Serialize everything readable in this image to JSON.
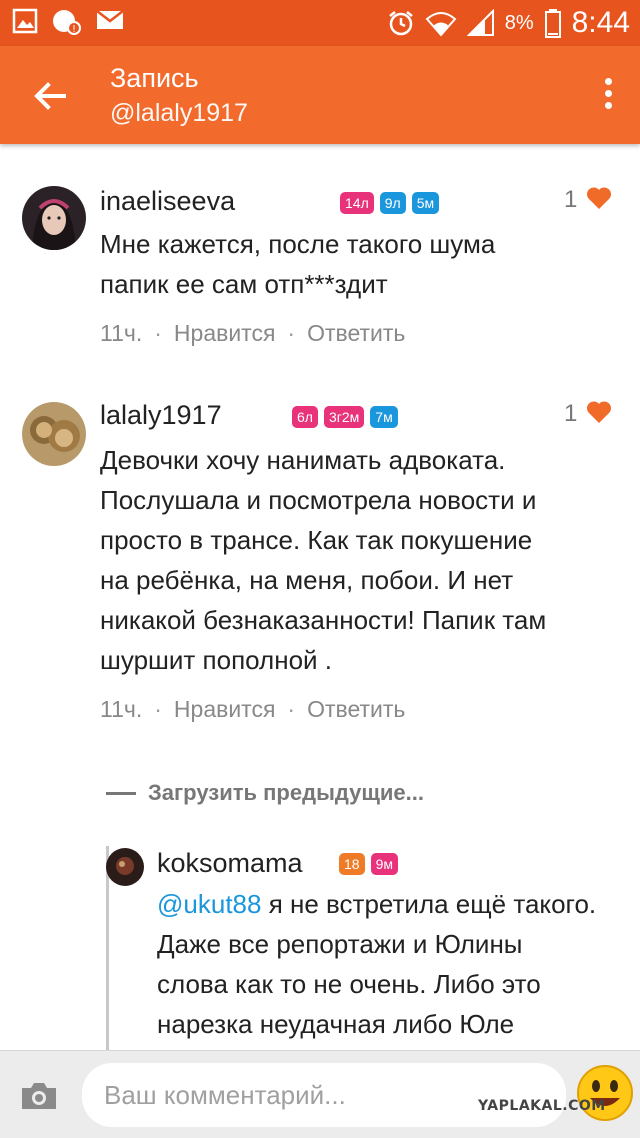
{
  "status_bar": {
    "battery_pct": "8%",
    "time": "8:44"
  },
  "app_bar": {
    "title": "Запись",
    "subtitle": "@lalaly1917"
  },
  "comments": [
    {
      "username": "inaeliseeva",
      "badges": [
        {
          "text": "14л",
          "color": "#e8327a"
        },
        {
          "text": "9л",
          "color": "#1a96dc"
        },
        {
          "text": "5м",
          "color": "#1a96dc"
        }
      ],
      "likes": "1",
      "text_lines": [
        "Мне кажется,  после такого шума",
        "папик ее сам отп***здит"
      ],
      "time": "11ч.",
      "like_label": "Нравится",
      "reply_label": "Ответить"
    },
    {
      "username": "lalaly1917",
      "badges": [
        {
          "text": "6л",
          "color": "#e8327a"
        },
        {
          "text": "3г2м",
          "color": "#e8327a"
        },
        {
          "text": "7м",
          "color": "#1a96dc"
        }
      ],
      "likes": "1",
      "text_lines": [
        "Девочки хочу нанимать  адвоката.",
        "Послушала и посмотрела новости и",
        "просто в трансе. Как так покушение",
        "на ребёнка, на меня, побои. И нет",
        "никакой безнаказанности! Папик там",
        "шуршит пополной ."
      ],
      "time": "11ч.",
      "like_label": "Нравится",
      "reply_label": "Ответить"
    }
  ],
  "load_previous_label": "Загрузить предыдущие...",
  "reply": {
    "username": "koksomama",
    "badges": [
      {
        "text": "18",
        "color": "#f07b26"
      },
      {
        "text": "9м",
        "color": "#e8327a"
      }
    ],
    "mention": "@ukut88",
    "first_line_rest": " я не встретила ещё такого.",
    "text_lines": [
      "Даже все репортажи и Юлины",
      "слова как то не очень. Либо это",
      "нарезка неудачная либо Юле"
    ]
  },
  "composer": {
    "placeholder": "Ваш комментарий..."
  },
  "watermark": "YAPLAKAL.COM",
  "colors": {
    "status_bar": "#e8541e",
    "app_bar": "#f26a2c",
    "heart": "#f06a28",
    "mention": "#1a96dc",
    "badge_pink": "#e8327a",
    "badge_blue": "#1a96dc",
    "badge_orange": "#f07b26"
  }
}
